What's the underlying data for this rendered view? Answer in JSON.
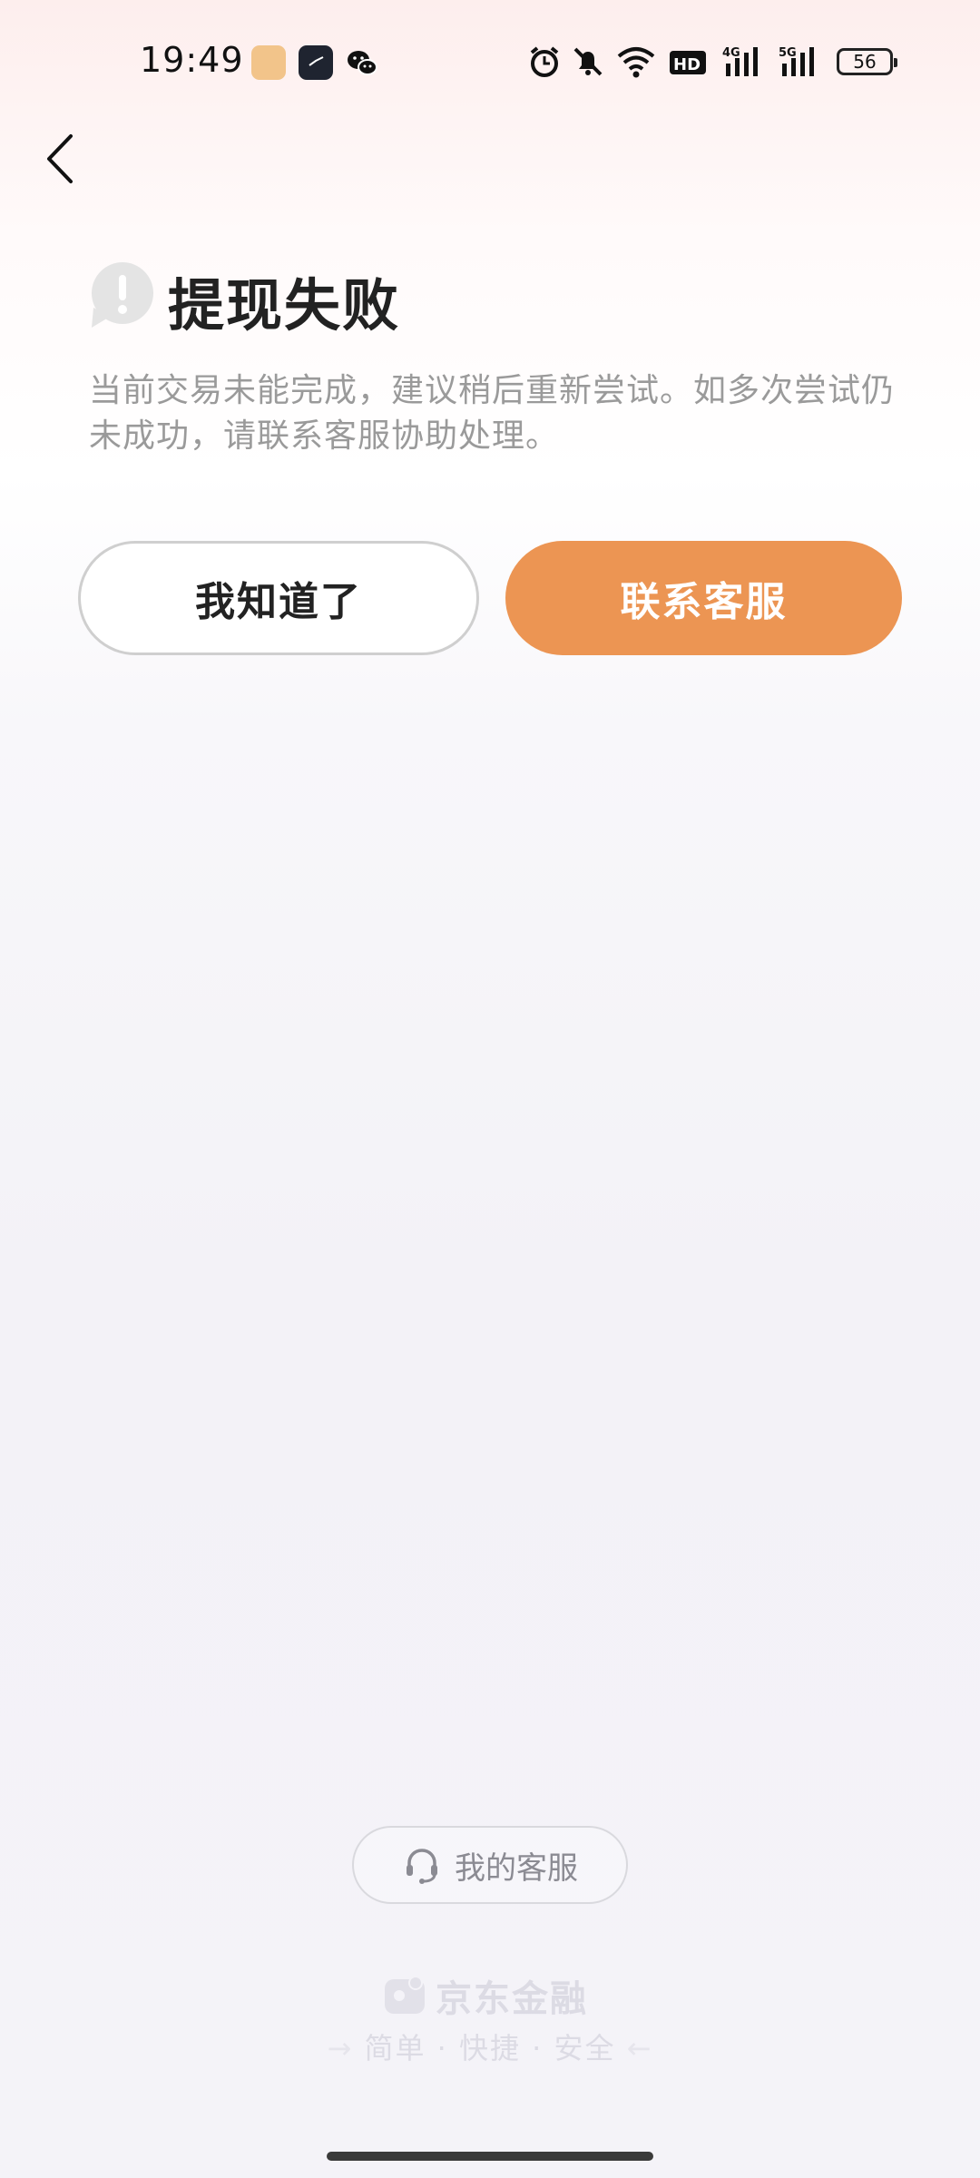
{
  "status_bar": {
    "time": "19:49",
    "battery": "56",
    "network_1": "4G",
    "network_2": "5G",
    "hd": "HD"
  },
  "page": {
    "title": "提现失败",
    "description": "当前交易未能完成，建议稍后重新尝试。如多次尝试仍未成功，请联系客服协助处理。"
  },
  "buttons": {
    "ok_label": "我知道了",
    "contact_label": "联系客服"
  },
  "footer": {
    "my_service_label": "我的客服",
    "brand_name": "京东金融",
    "brand_tagline": "简单 · 快捷 · 安全"
  },
  "colors": {
    "accent": "#ec9553",
    "text_primary": "#222222",
    "text_secondary": "#9a9a9a"
  }
}
